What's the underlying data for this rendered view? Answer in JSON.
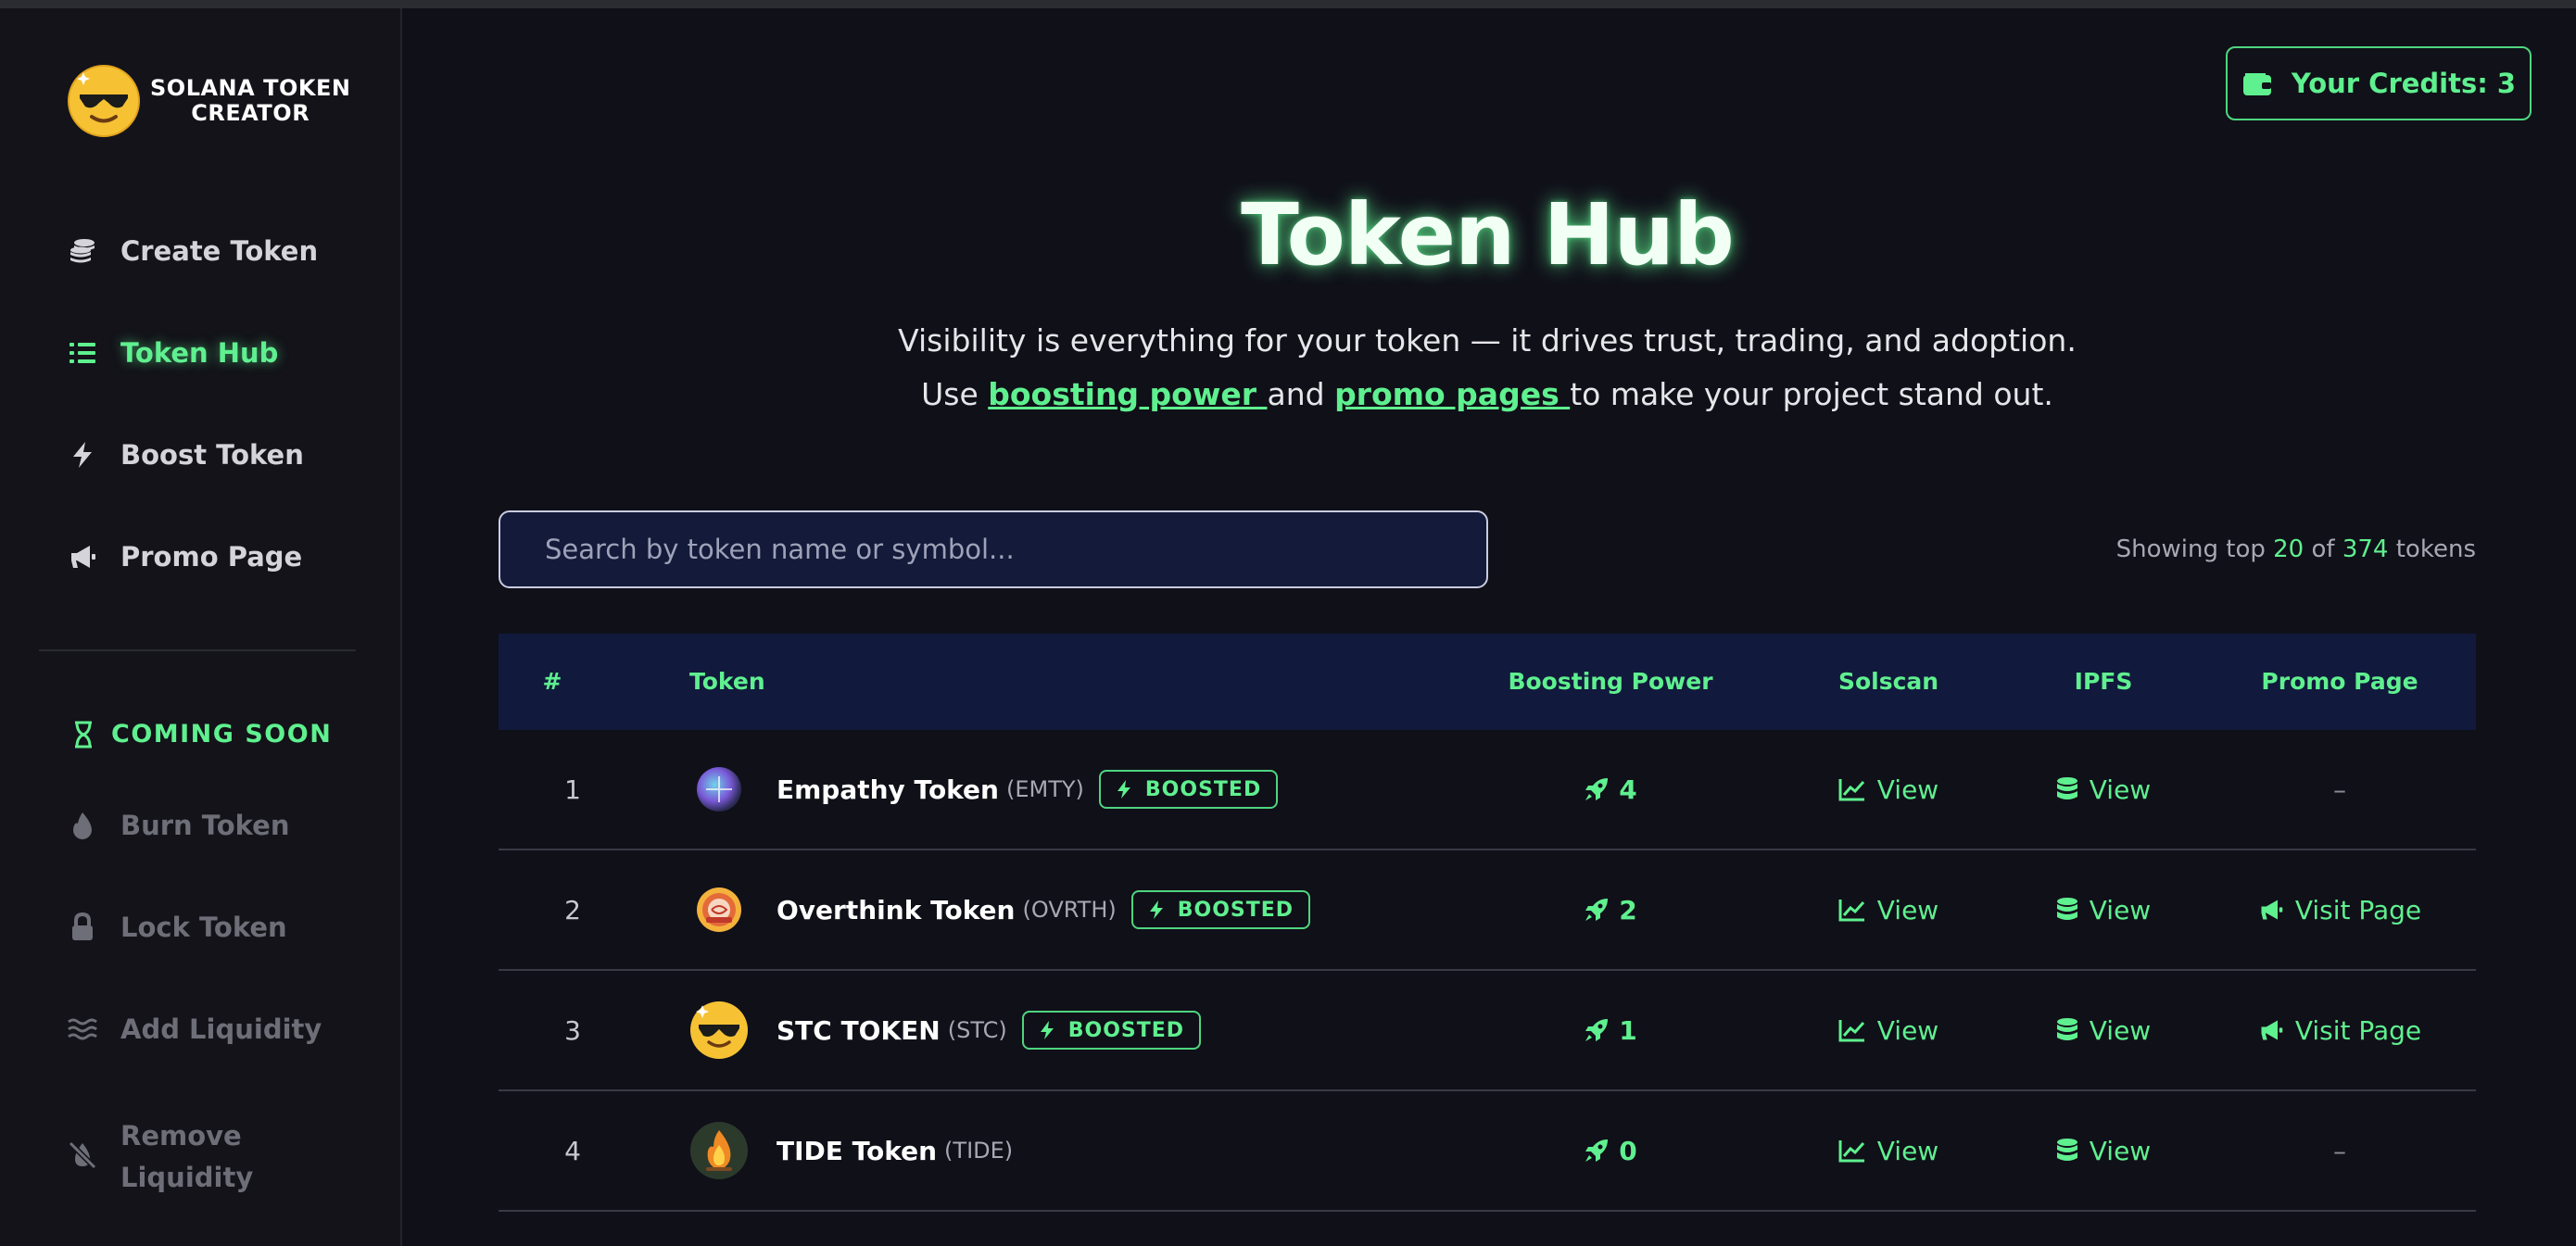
{
  "sidebar": {
    "brand_line1": "SOLANA TOKEN",
    "brand_line2": "CREATOR",
    "items": [
      {
        "label": "Create Token",
        "icon": "coins-icon"
      },
      {
        "label": "Token Hub",
        "icon": "list-icon",
        "active": true
      },
      {
        "label": "Boost Token",
        "icon": "bolt-icon"
      },
      {
        "label": "Promo Page",
        "icon": "megaphone-icon"
      }
    ],
    "coming_soon_label": "COMING SOON",
    "soon_items": [
      {
        "label": "Burn Token",
        "icon": "fire-icon"
      },
      {
        "label": "Lock Token",
        "icon": "lock-icon"
      },
      {
        "label": "Add Liquidity",
        "icon": "water-icon"
      },
      {
        "label_line1": "Remove",
        "label_line2": "Liquidity",
        "icon": "no-water-icon"
      }
    ]
  },
  "header": {
    "credits_label": "Your Credits: 3"
  },
  "hero": {
    "title": "Token Hub",
    "line1": "Visibility is everything for your token — it drives trust, trading, and adoption.",
    "line2_pre": "Use ",
    "link1": "boosting power ",
    "line2_mid": "and ",
    "link2": "promo pages ",
    "line2_post": "to make your project stand out."
  },
  "search": {
    "placeholder": "Search by token name or symbol...",
    "value": ""
  },
  "summary": {
    "prefix": "Showing top ",
    "shown": "20",
    "of": " of ",
    "total": "374",
    "suffix": " tokens"
  },
  "table": {
    "columns": {
      "rank": "#",
      "token": "Token",
      "boost": "Boosting Power",
      "solscan": "Solscan",
      "ipfs": "IPFS",
      "promo": "Promo Page"
    },
    "boosted_label": "BOOSTED",
    "view_label": "View",
    "visit_label": "Visit Page",
    "empty_label": "–",
    "rows": [
      {
        "rank": "1",
        "name": "Empathy Token",
        "symbol": "(EMTY)",
        "boosted": true,
        "power": "4",
        "promo": false
      },
      {
        "rank": "2",
        "name": "Overthink Token",
        "symbol": "(OVRTH)",
        "boosted": true,
        "power": "2",
        "promo": true
      },
      {
        "rank": "3",
        "name": "STC TOKEN",
        "symbol": "(STC)",
        "boosted": true,
        "power": "1",
        "promo": true
      },
      {
        "rank": "4",
        "name": "TIDE Token",
        "symbol": "(TIDE)",
        "boosted": false,
        "power": "0",
        "promo": false
      }
    ]
  },
  "colors": {
    "accent": "#5ff08f",
    "background": "#101019",
    "sidebar": "#131319",
    "table_header": "#111a3c"
  }
}
